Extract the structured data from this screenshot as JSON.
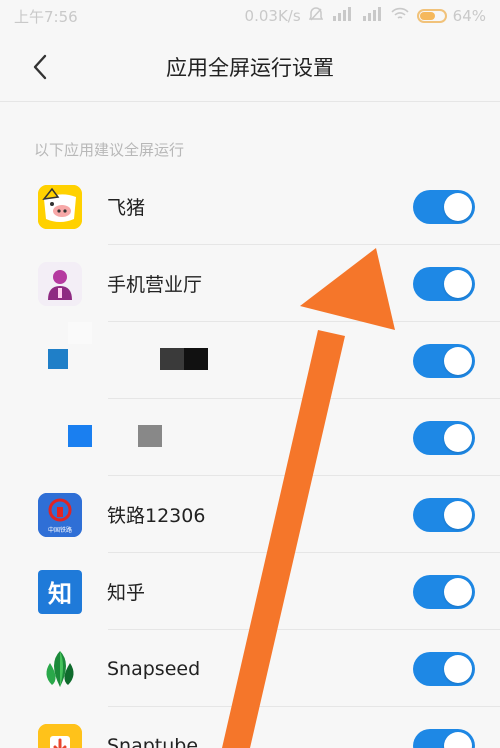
{
  "status_bar": {
    "time": "上午7:56",
    "network_speed": "0.03K/s",
    "battery": "64%",
    "battery_level": 0.64
  },
  "header": {
    "title": "应用全屏运行设置",
    "back_icon": "chevron-left-icon"
  },
  "section_label": "以下应用建议全屏运行",
  "apps": [
    {
      "name": "飞猪",
      "icon": "fliggy-app-icon",
      "enabled": true
    },
    {
      "name": "手机营业厅",
      "icon": "mobile-hall-app-icon",
      "enabled": true
    },
    {
      "name": "",
      "icon": "redacted-app-icon",
      "enabled": true
    },
    {
      "name": "",
      "icon": "redacted-app-icon",
      "enabled": true
    },
    {
      "name": "铁路12306",
      "icon": "railway-12306-app-icon",
      "icon_caption": "中国铁路",
      "enabled": true
    },
    {
      "name": "知乎",
      "icon": "zhihu-app-icon",
      "icon_text": "知",
      "enabled": true
    },
    {
      "name": "Snapseed",
      "icon": "snapseed-app-icon",
      "enabled": true
    },
    {
      "name": "Snaptube",
      "icon": "snaptube-app-icon",
      "enabled": true
    }
  ],
  "colors": {
    "toggle_on": "#1e88e5",
    "arrow": "#f5762a",
    "status_text": "#c9c9c9",
    "separator": "#e6e6e6"
  }
}
